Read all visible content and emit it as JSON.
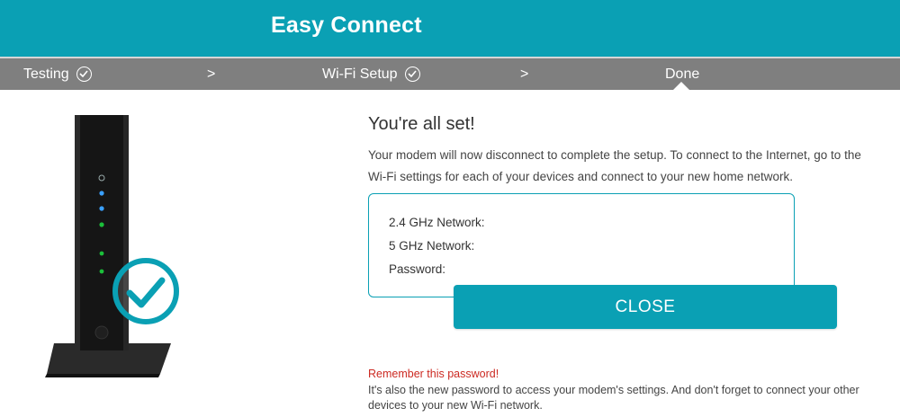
{
  "header": {
    "title": "Easy Connect"
  },
  "steps": [
    {
      "label": "Testing",
      "completed": true
    },
    {
      "label": ">"
    },
    {
      "label": "Wi-Fi Setup",
      "completed": true
    },
    {
      "label": ">"
    },
    {
      "label": "Done",
      "active": true
    }
  ],
  "main": {
    "title": "You're all set!",
    "description": "Your modem will now disconnect to complete the setup. To connect to the Internet, go to the Wi-Fi settings for each of your devices and connect to your new home network.",
    "network_box": {
      "ghz24_label": "2.4 GHz Network:",
      "ghz5_label": "5 GHz Network:",
      "password_label": "Password:"
    },
    "close_label": "CLOSE",
    "warning": "Remember this password!",
    "note": "It's also the new password to access your modem's settings. And don't forget to connect your other devices to your new Wi-Fi network."
  },
  "colors": {
    "accent": "#0aa0b4",
    "step_bar": "#7f7f7f",
    "warning": "#cc2a22"
  },
  "icons": [
    "check-circle-icon",
    "modem-image",
    "success-check-icon"
  ]
}
